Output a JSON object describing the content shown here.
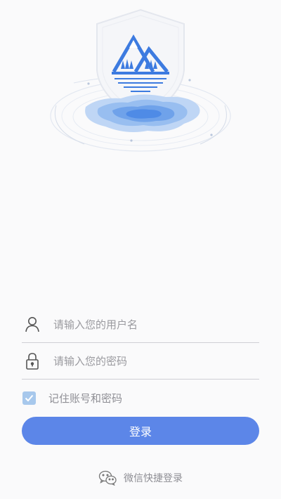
{
  "login": {
    "username_placeholder": "请输入您的用户名",
    "password_placeholder": "请输入您的密码",
    "remember_label": "记住账号和密码",
    "remember_checked": true,
    "submit_label": "登录",
    "wechat_label": "微信快捷登录"
  },
  "icons": {
    "hero": "mountain-shield-lake-icon",
    "username": "user-icon",
    "password": "lock-icon",
    "remember": "checkmark-icon",
    "wechat": "wechat-icon"
  },
  "colors": {
    "background": "#fafafb",
    "accent": "#5c86e8",
    "logo_blue": "#3d7be0",
    "checkbox": "#a7c8ec",
    "muted_text": "#8f8f95",
    "divider": "#cfcfd4"
  }
}
